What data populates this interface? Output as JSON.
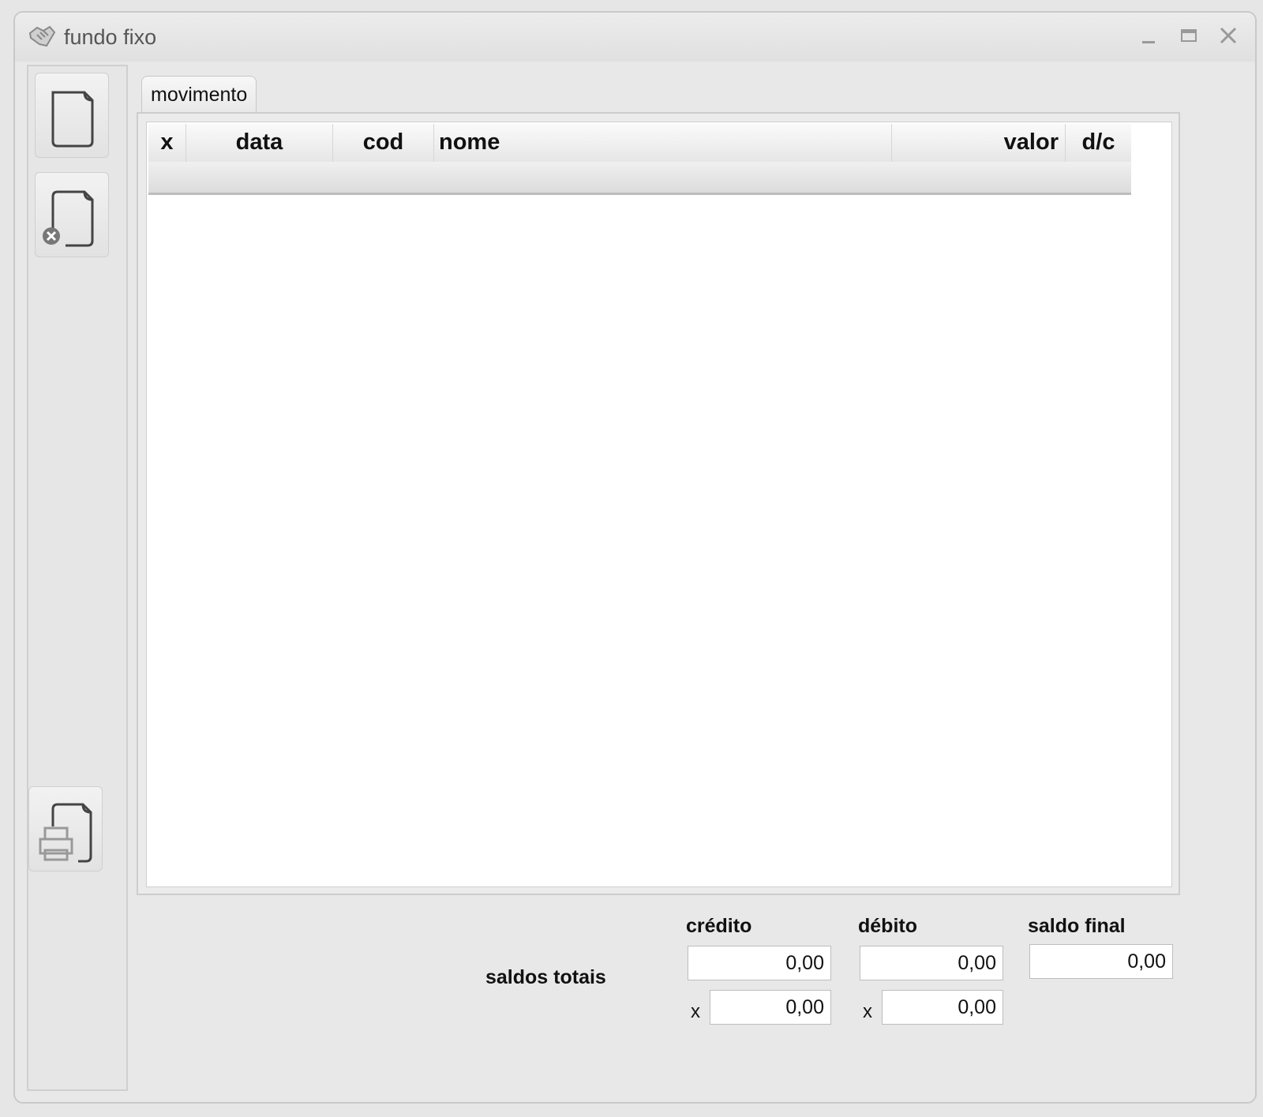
{
  "window": {
    "title": "fundo fixo"
  },
  "tabs": [
    {
      "label": "movimento"
    }
  ],
  "grid": {
    "columns": [
      "x",
      "data",
      "cod",
      "nome",
      "valor",
      "d/c"
    ],
    "rows": []
  },
  "totals": {
    "label": "saldos totais",
    "credito": {
      "label": "crédito",
      "value": "0,00",
      "selected_prefix": "x",
      "selected_value": "0,00"
    },
    "debito": {
      "label": "débito",
      "value": "0,00",
      "selected_prefix": "x",
      "selected_value": "0,00"
    },
    "saldo_final": {
      "label": "saldo final",
      "value": "0,00"
    }
  },
  "icons": {
    "app": "handshake-icon",
    "new": "new-document-icon",
    "delete": "delete-document-icon",
    "print": "print-document-icon"
  }
}
